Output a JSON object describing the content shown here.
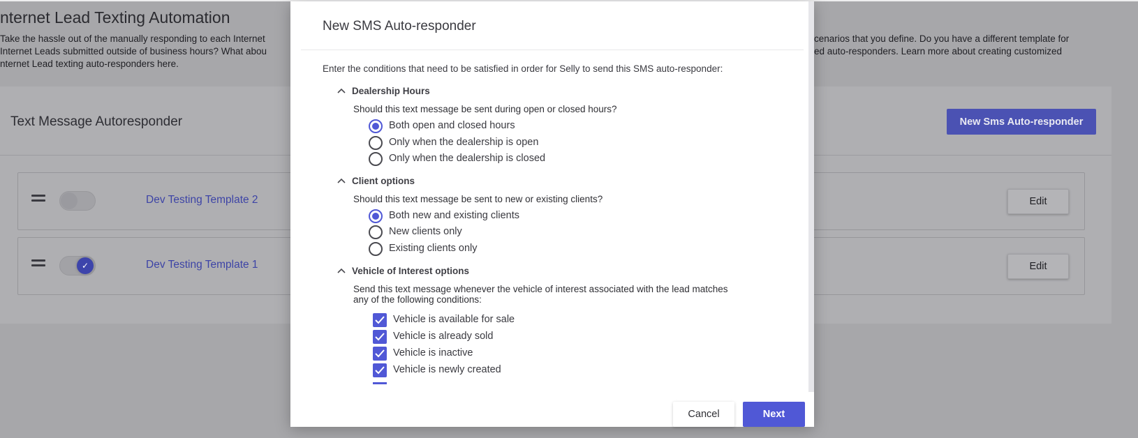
{
  "background": {
    "page_title": "nternet Lead Texting Automation",
    "description_lines": [
      "Take the hassle out of the manually responding to each Internet",
      "Internet Leads submitted outside of business hours? What abou",
      "nternet Lead texting auto-responders here."
    ],
    "description_right_lines": [
      "cenarios that you define. Do you have a different template for",
      "ed auto-responders. Learn more about creating customized"
    ],
    "card_title": "Text Message Autoresponder",
    "new_button_label": "New Sms Auto-responder",
    "templates": [
      {
        "name": "Dev Testing Template 2",
        "enabled": false,
        "edit_label": "Edit"
      },
      {
        "name": "Dev Testing Template 1",
        "enabled": true,
        "edit_label": "Edit"
      }
    ]
  },
  "modal": {
    "title": "New SMS Auto-responder",
    "intro": "Enter the conditions that need to be satisfied in order for Selly to send this SMS auto-responder:",
    "sections": [
      {
        "title": "Dealership Hours",
        "question": "Should this text message be sent during open or closed hours?",
        "options": [
          {
            "label": "Both open and closed hours",
            "checked": true
          },
          {
            "label": "Only when the dealership is open",
            "checked": false
          },
          {
            "label": "Only when the dealership is closed",
            "checked": false
          }
        ]
      },
      {
        "title": "Client options",
        "question": "Should this text message be sent to new or existing clients?",
        "options": [
          {
            "label": "Both new and existing clients",
            "checked": true
          },
          {
            "label": "New clients only",
            "checked": false
          },
          {
            "label": "Existing clients only",
            "checked": false
          }
        ]
      },
      {
        "title": "Vehicle of Interest options",
        "question_line1": "Send this text message whenever the vehicle of interest associated with the lead matches",
        "question_line2": "any of the following conditions:",
        "options": [
          {
            "label": "Vehicle is available for sale",
            "checked": true
          },
          {
            "label": "Vehicle is already sold",
            "checked": true
          },
          {
            "label": "Vehicle is inactive",
            "checked": true
          },
          {
            "label": "Vehicle is newly created",
            "checked": true
          }
        ]
      }
    ],
    "cancel_label": "Cancel",
    "next_label": "Next"
  },
  "colors": {
    "accent": "#5058d6",
    "overlay_bg": "#a7a7aa",
    "modal_bg": "#ffffff"
  }
}
